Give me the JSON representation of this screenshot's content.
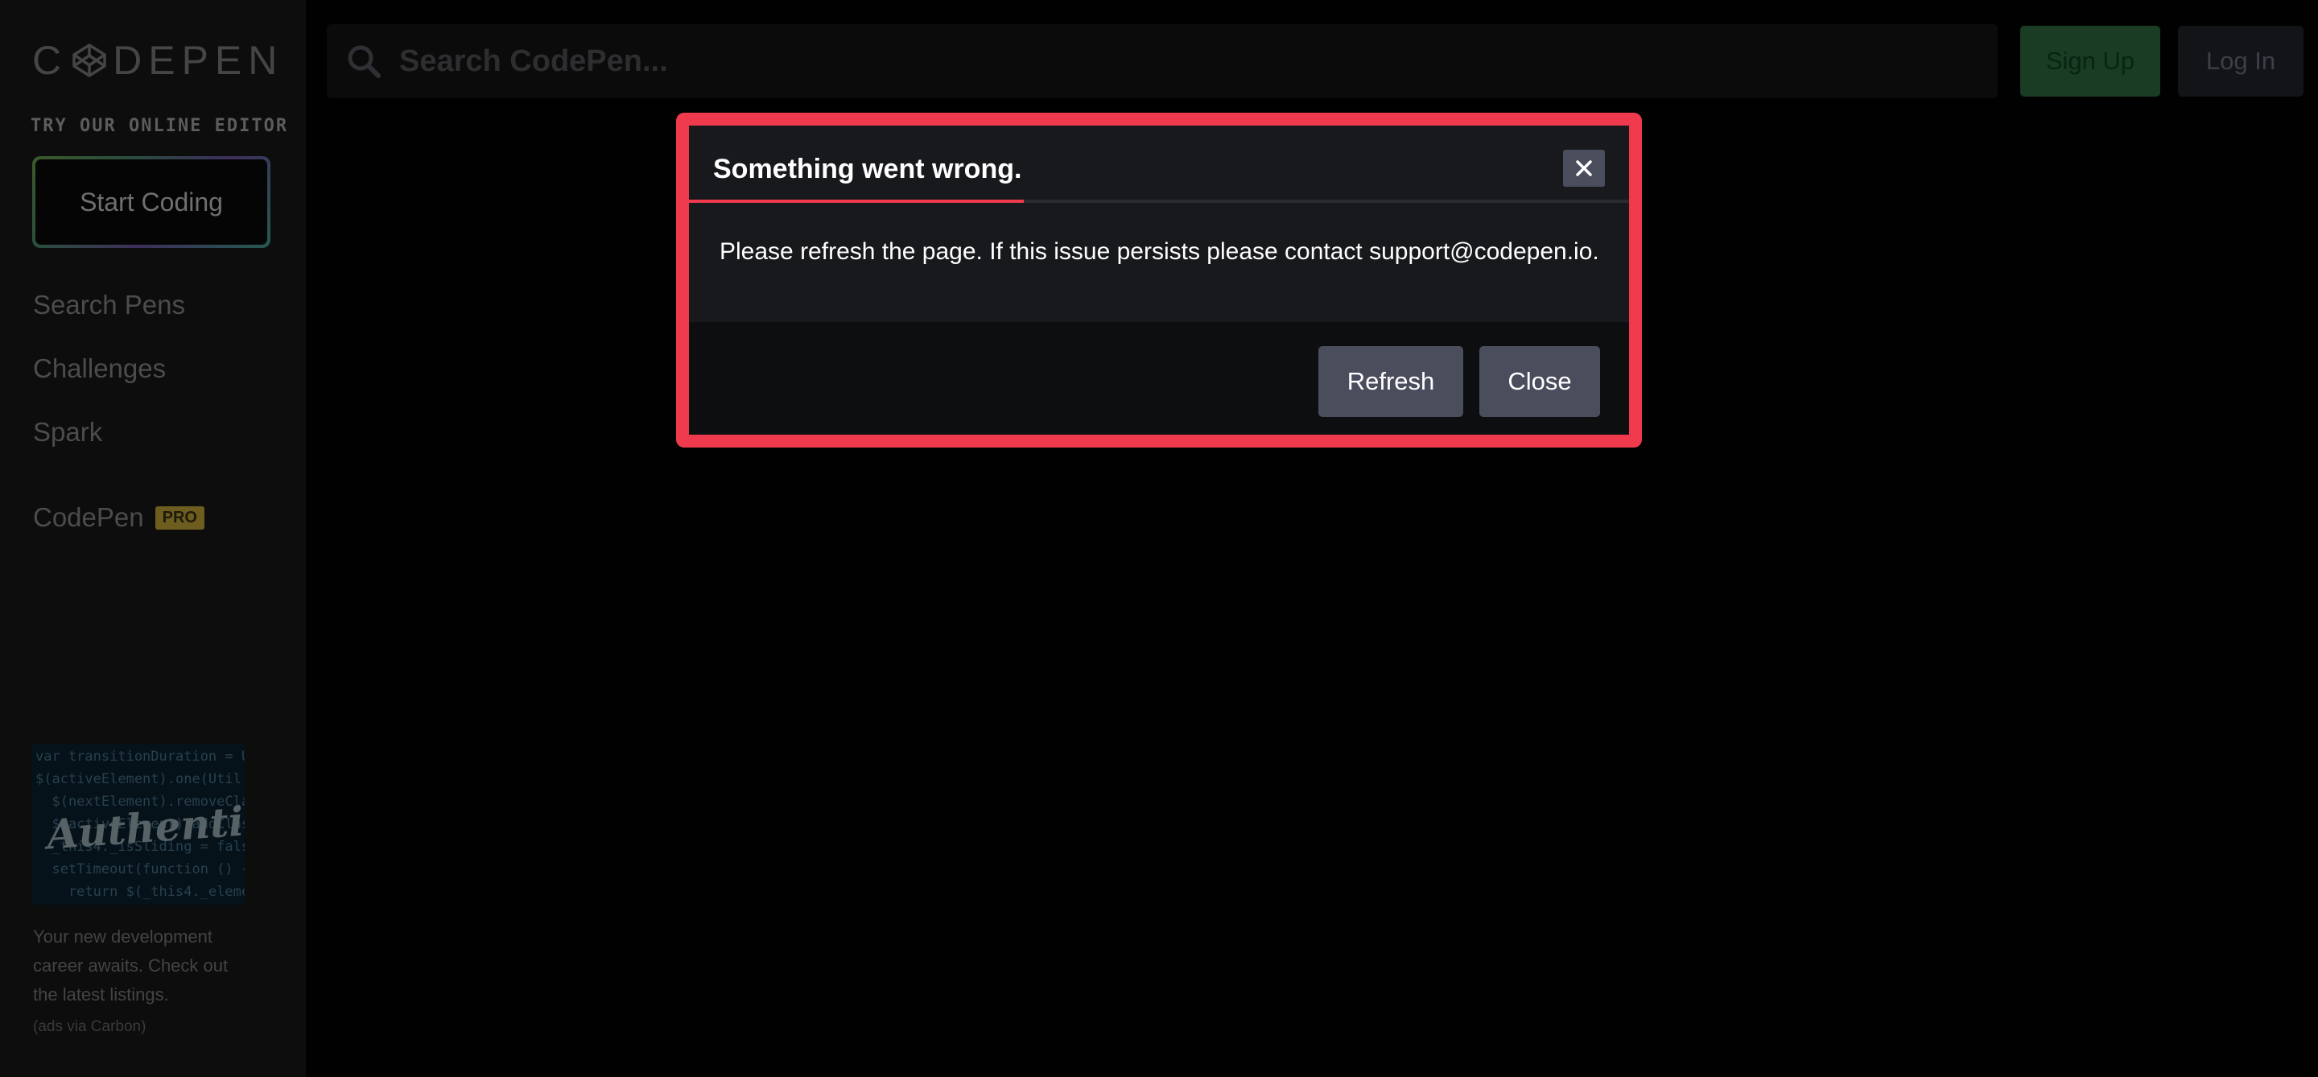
{
  "brand": {
    "logo_text_left": "C",
    "logo_text_right": "DEPEN"
  },
  "sidebar": {
    "try_label": "TRY OUR ONLINE EDITOR",
    "start_button": "Start Coding",
    "nav": [
      {
        "label": "Search Pens"
      },
      {
        "label": "Challenges"
      },
      {
        "label": "Spark"
      }
    ],
    "codepen_label": "CodePen",
    "pro_badge": "PRO",
    "ad": {
      "image_text": "Authentic",
      "text": "Your new development career awaits. Check out the latest listings.",
      "via": "(ads via Carbon)"
    }
  },
  "header": {
    "search_placeholder": "Search CodePen...",
    "signup_label": "Sign Up",
    "login_label": "Log In"
  },
  "modal": {
    "title": "Something went wrong.",
    "message": "Please refresh the page. If this issue persists please contact support@codepen.io.",
    "refresh_label": "Refresh",
    "close_label": "Close",
    "close_icon_glyph": "✕"
  },
  "colors": {
    "highlight": "#ef3a4d",
    "modal_bg": "#18191d",
    "button_bg": "#4a4d5c",
    "signup_bg": "#1a3b24"
  }
}
